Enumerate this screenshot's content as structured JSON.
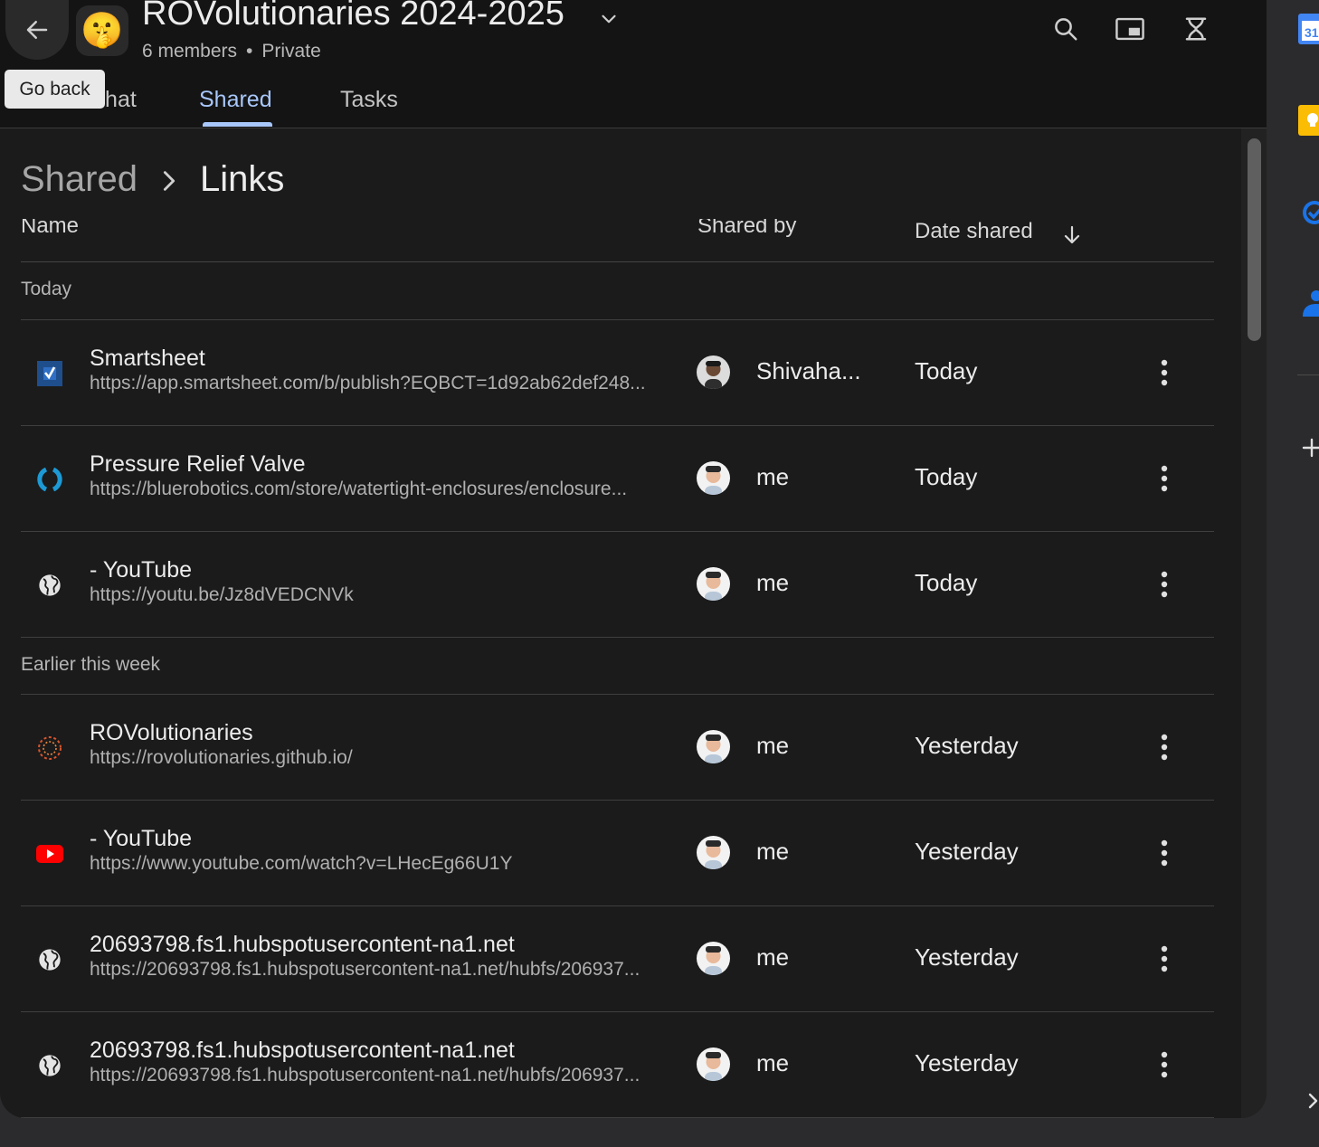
{
  "header": {
    "group_emoji": "🤫",
    "title": "ROVolutionaries 2024-2025",
    "members": "6 members",
    "privacy": "Private",
    "icons": [
      "search-icon",
      "picture-in-picture-icon",
      "hourglass-icon"
    ]
  },
  "tooltip": "Go back",
  "tabs": [
    {
      "label": "Chat"
    },
    {
      "label": "Shared"
    },
    {
      "label": "Tasks"
    }
  ],
  "breadcrumb": {
    "root": "Shared",
    "current": "Links"
  },
  "columns": {
    "name": "Name",
    "shared_by": "Shared by",
    "date_shared": "Date shared"
  },
  "sections": [
    {
      "label": "Today",
      "rows": [
        {
          "title": "Smartsheet",
          "url": "https://app.smartsheet.com/b/publish?EQBCT=1d92ab62def248...",
          "sharer": "Shivaha...",
          "date": "Today",
          "favicon": "smartsheet-icon"
        },
        {
          "title": "Pressure Relief Valve",
          "url": "https://bluerobotics.com/store/watertight-enclosures/enclosure...",
          "sharer": "me",
          "date": "Today",
          "favicon": "bluerobotics-icon"
        },
        {
          "title": "- YouTube",
          "url": "https://youtu.be/Jz8dVEDCNVk",
          "sharer": "me",
          "date": "Today",
          "favicon": "globe-icon"
        }
      ]
    },
    {
      "label": "Earlier this week",
      "rows": [
        {
          "title": "ROVolutionaries",
          "url": "https://rovolutionaries.github.io/",
          "sharer": "me",
          "date": "Yesterday",
          "favicon": "rovolutionaries-icon"
        },
        {
          "title": "- YouTube",
          "url": "https://www.youtube.com/watch?v=LHecEg66U1Y",
          "sharer": "me",
          "date": "Yesterday",
          "favicon": "youtube-icon"
        },
        {
          "title": "20693798.fs1.hubspotusercontent-na1.net",
          "url": "https://20693798.fs1.hubspotusercontent-na1.net/hubfs/206937...",
          "sharer": "me",
          "date": "Yesterday",
          "favicon": "globe-icon"
        },
        {
          "title": "20693798.fs1.hubspotusercontent-na1.net",
          "url": "https://20693798.fs1.hubspotusercontent-na1.net/hubfs/206937...",
          "sharer": "me",
          "date": "Yesterday",
          "favicon": "globe-icon"
        }
      ]
    }
  ],
  "sidebar": {
    "calendar_day": "31",
    "apps": [
      "calendar-icon",
      "keep-icon",
      "tasks-icon",
      "contacts-icon",
      "add-icon",
      "expand-icon"
    ]
  },
  "colors": {
    "accent": "#a8c7fa",
    "background": "#1b1b1b",
    "header": "#141414"
  }
}
